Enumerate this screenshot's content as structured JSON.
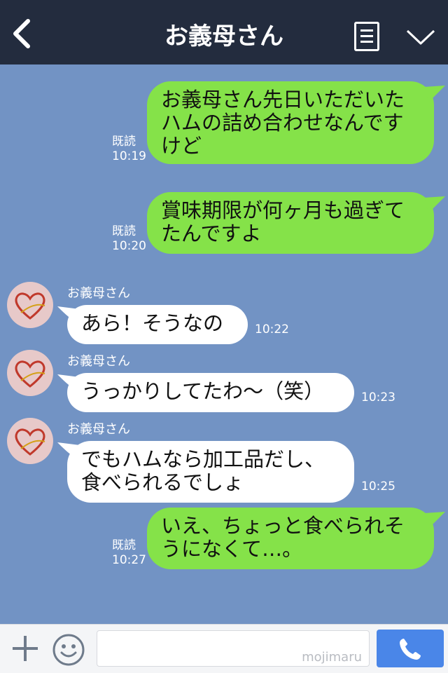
{
  "header": {
    "title": "お義母さん"
  },
  "messages": [
    {
      "dir": "sent",
      "text_lines": [
        "お義母さん先日いただいた",
        "ハムの詰め合わせなんです",
        "けど"
      ],
      "read": "既読",
      "time": "10:19"
    },
    {
      "dir": "sent",
      "text_lines": [
        "賞味期限が何ヶ月も過ぎて",
        "たんですよ"
      ],
      "read": "既読",
      "time": "10:20"
    },
    {
      "dir": "recv",
      "sender": "お義母さん",
      "text_lines": [
        "あら！そうなの"
      ],
      "time": "10:22"
    },
    {
      "dir": "recv",
      "sender": "お義母さん",
      "text_lines": [
        "うっかりしてたわ〜（笑）"
      ],
      "time": "10:23"
    },
    {
      "dir": "recv",
      "sender": "お義母さん",
      "text_lines": [
        "でもハムなら加工品だし、",
        "食べられるでしょ"
      ],
      "time": "10:25"
    },
    {
      "dir": "sent",
      "text_lines": [
        "いえ、ちょっと食べられそ",
        "うになくて…。"
      ],
      "read": "既読",
      "time": "10:27"
    }
  ],
  "input": {
    "placeholder": "",
    "watermark": "mojimaru"
  },
  "icons": {
    "back": "back-chevron-icon",
    "menu": "menu-list-icon",
    "collapse": "chevron-down-icon",
    "plus": "plus-icon",
    "emoji": "smile-icon",
    "call": "phone-icon"
  },
  "colors": {
    "header_bg": "#232c3e",
    "chat_bg": "#7293c4",
    "sent_bubble": "#85e249",
    "recv_bubble": "#ffffff",
    "call_button": "#4a86e8"
  }
}
